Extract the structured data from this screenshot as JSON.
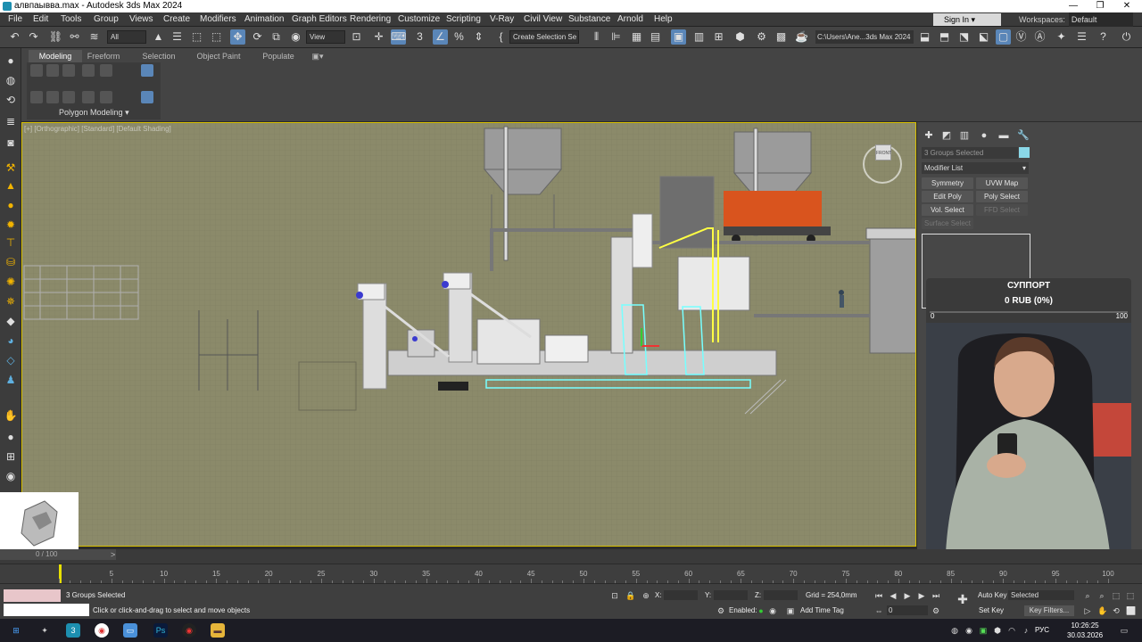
{
  "window": {
    "title": "алвпаывва.max - Autodesk 3ds Max 2024"
  },
  "menubar": {
    "items": [
      "File",
      "Edit",
      "Tools",
      "Group",
      "Views",
      "Create",
      "Modifiers",
      "Animation",
      "Graph Editors",
      "Rendering",
      "Customize",
      "Scripting",
      "V-Ray",
      "Civil View",
      "Substance",
      "Arnold",
      "Help"
    ],
    "sign_in": "Sign In",
    "workspaces_label": "Workspaces:",
    "workspaces_value": "Default"
  },
  "toolbar": {
    "filter": "All",
    "ref_coord": "View",
    "selection_set": "Create Selection Se",
    "project_path": "C:\\Users\\Ane...3ds Max 2024"
  },
  "ribbon": {
    "tabs": [
      "Modeling",
      "Freeform",
      "Selection",
      "Object Paint",
      "Populate"
    ],
    "active_tab": "Modeling",
    "panel_label": "Polygon Modeling"
  },
  "viewport": {
    "label": "[+] [Orthographic] [Standard] [Default Shading]",
    "viewcube_face": "FRONT"
  },
  "command_panel": {
    "object_name": "3 Groups Selected",
    "object_color": "#8ad8e8",
    "modifier_list": "Modifier List",
    "modifier_buttons": [
      {
        "label": "Symmetry",
        "enabled": true
      },
      {
        "label": "UVW Map",
        "enabled": true
      },
      {
        "label": "Edit Poly",
        "enabled": true
      },
      {
        "label": "Poly Select",
        "enabled": true
      },
      {
        "label": "Vol. Select",
        "enabled": true
      },
      {
        "label": "FFD Select",
        "enabled": false
      },
      {
        "label": "Surface Select",
        "enabled": false
      }
    ]
  },
  "donation": {
    "title": "СУППОРТ",
    "amount": "0 RUB (0%)",
    "progress": 0,
    "min": "0",
    "max": "100"
  },
  "timeline": {
    "slider_label": "0 / 100",
    "ticks": [
      "5",
      "10",
      "15",
      "20",
      "25",
      "30",
      "35",
      "40",
      "45",
      "50",
      "55",
      "60",
      "65",
      "70",
      "75",
      "80",
      "85",
      "90",
      "95",
      "100"
    ]
  },
  "status": {
    "selection": "3 Groups Selected",
    "prompt": "Click or click-and-drag to select and move objects",
    "x_label": "X:",
    "y_label": "Y:",
    "z_label": "Z:",
    "grid": "Grid = 254,0mm",
    "enabled_label": "Enabled:",
    "add_time_tag": "Add Time Tag",
    "auto_key": "Auto Key",
    "set_key": "Set Key",
    "selected": "Selected",
    "key_filters": "Key Filters...",
    "frame": "0"
  },
  "taskbar": {
    "lang": "РУС",
    "time": "10:26:25",
    "date": "30.03.2026"
  }
}
